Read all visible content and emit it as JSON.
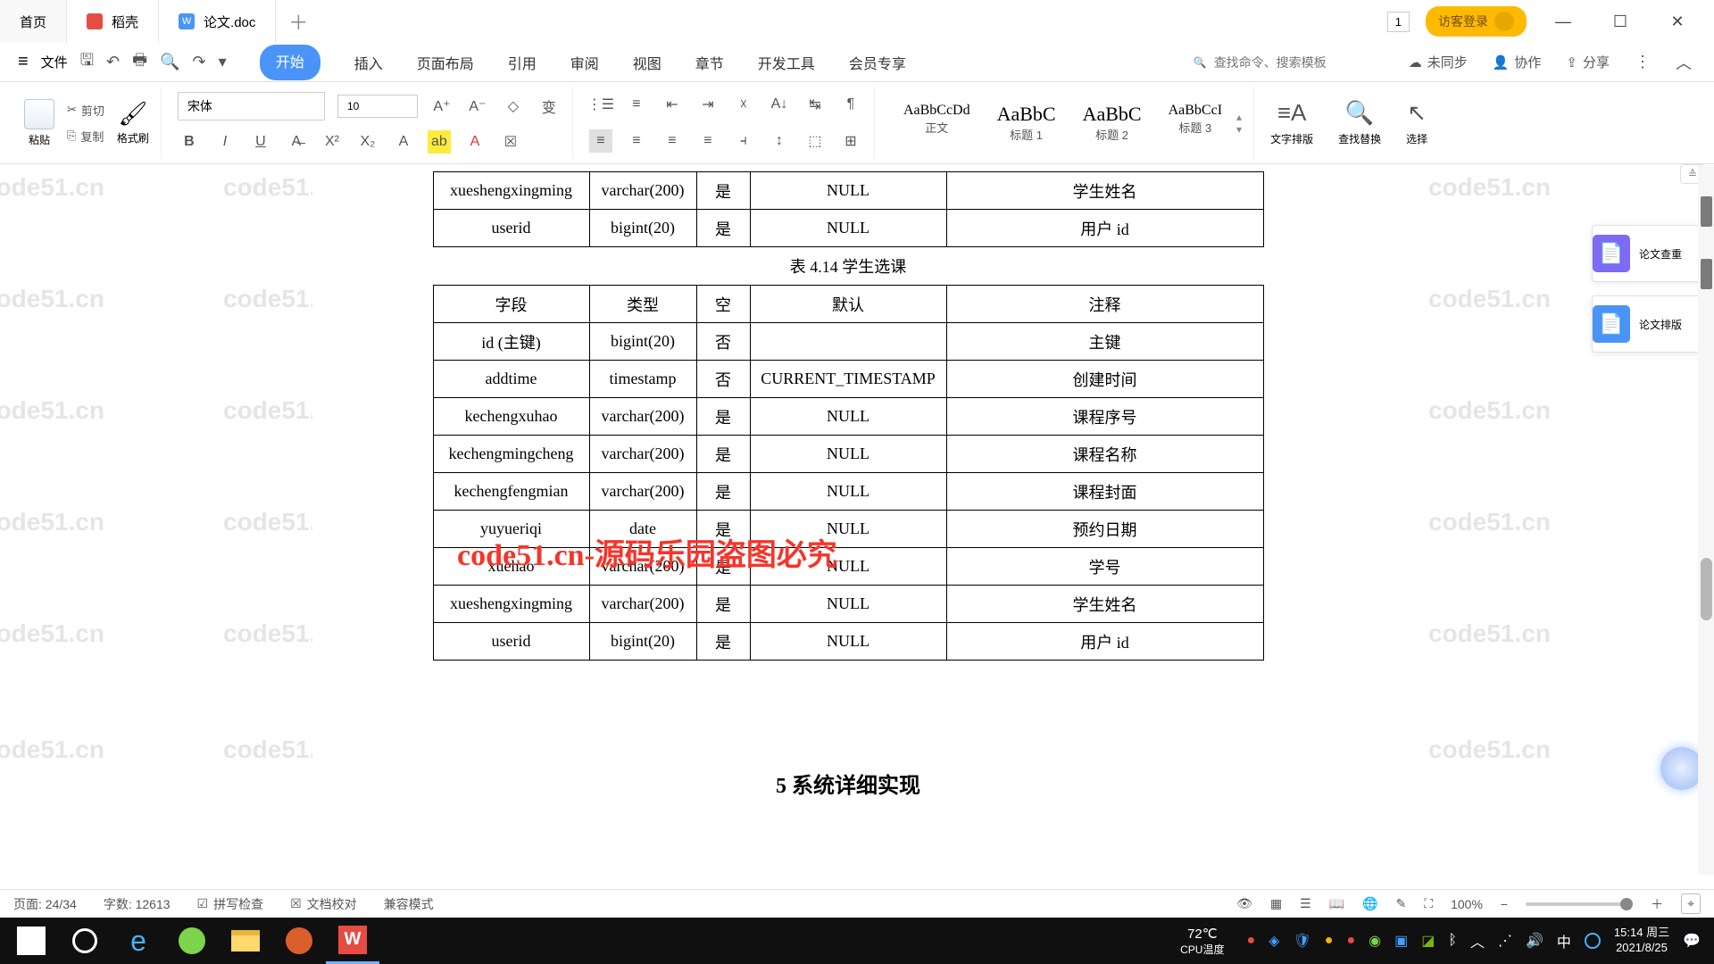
{
  "tabs": [
    {
      "label": "首页"
    },
    {
      "label": "稻壳"
    },
    {
      "label": "论文.doc"
    }
  ],
  "title_right": {
    "badge": "1",
    "login": "访客登录"
  },
  "menu": {
    "file": "文件",
    "tabs": [
      "开始",
      "插入",
      "页面布局",
      "引用",
      "审阅",
      "视图",
      "章节",
      "开发工具",
      "会员专享"
    ],
    "search_ph": "查找命令、搜索模板",
    "unsync": "未同步",
    "collab": "协作",
    "share": "分享"
  },
  "ribbon": {
    "paste": "粘贴",
    "cut": "剪切",
    "copy": "复制",
    "format_painter": "格式刷",
    "font_name": "宋体",
    "font_size": "10",
    "style_preview": "AaBbCcDd",
    "style_preview2": "AaBbC",
    "style_preview3": "AaBbC",
    "style_preview4": "AaBbCcI",
    "styles": [
      "正文",
      "标题 1",
      "标题 2",
      "标题 3"
    ],
    "typeset": "文字排版",
    "find": "查找替换",
    "select": "选择"
  },
  "doc": {
    "t1_rows": [
      [
        "xueshengxingming",
        "varchar(200)",
        "是",
        "NULL",
        "学生姓名"
      ],
      [
        "userid",
        "bigint(20)",
        "是",
        "NULL",
        "用户 id"
      ]
    ],
    "caption": "表 4.14  学生选课",
    "headers": [
      "字段",
      "类型",
      "空",
      "默认",
      "注释"
    ],
    "t2_rows": [
      [
        "id (主键)",
        "bigint(20)",
        "否",
        "",
        "主键"
      ],
      [
        "addtime",
        "timestamp",
        "否",
        "CURRENT_TIMESTAMP",
        "创建时间"
      ],
      [
        "kechengxuhao",
        "varchar(200)",
        "是",
        "NULL",
        "课程序号"
      ],
      [
        "kechengmingcheng",
        "varchar(200)",
        "是",
        "NULL",
        "课程名称"
      ],
      [
        "kechengfengmian",
        "varchar(200)",
        "是",
        "NULL",
        "课程封面"
      ],
      [
        "yuyueriqi",
        "date",
        "是",
        "NULL",
        "预约日期"
      ],
      [
        "xuehao",
        "varchar(200)",
        "是",
        "NULL",
        "学号"
      ],
      [
        "xueshengxingming",
        "varchar(200)",
        "是",
        "NULL",
        "学生姓名"
      ],
      [
        "userid",
        "bigint(20)",
        "是",
        "NULL",
        "用户 id"
      ]
    ],
    "heading": "5 系统详细实现",
    "watermark": "code51.cn",
    "red_overlay": "code51.cn-源码乐园盗图必究"
  },
  "side": {
    "check": "论文查重",
    "layout": "论文排版"
  },
  "status": {
    "page": "页面: 24/34",
    "words": "字数: 12613",
    "spell": "拼写检查",
    "review": "文档校对",
    "compat": "兼容模式",
    "zoom": "100%"
  },
  "taskbar": {
    "temp": "72℃",
    "temp_label": "CPU温度",
    "ime": "中",
    "time": "15:14",
    "day": "周三",
    "date": "2021/8/25"
  }
}
